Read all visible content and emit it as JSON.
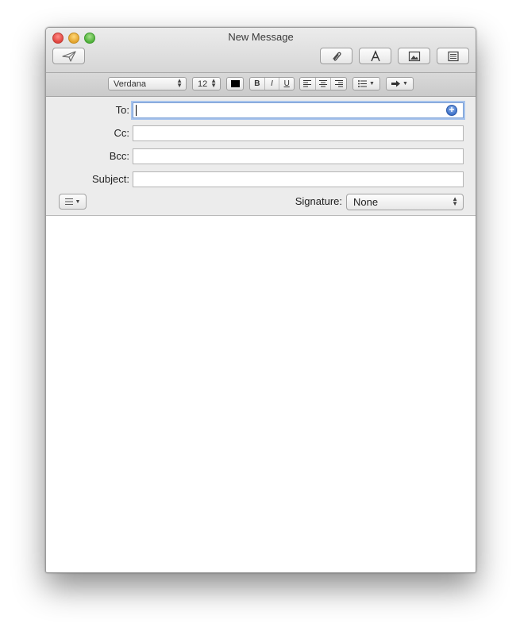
{
  "window": {
    "title": "New Message"
  },
  "toolbar": {
    "send_icon": "paper-plane-icon",
    "attach_icon": "paperclip-icon",
    "fonts_icon": "letter-a-icon",
    "photo_icon": "photo-browser-icon",
    "template_icon": "stationery-icon"
  },
  "format": {
    "font": "Verdana",
    "size": "12",
    "text_color": "#000000",
    "bold": "B",
    "italic": "I",
    "underline": "U"
  },
  "headers": {
    "to_label": "To:",
    "cc_label": "Cc:",
    "bcc_label": "Bcc:",
    "subject_label": "Subject:",
    "to_value": "",
    "cc_value": "",
    "bcc_value": "",
    "subject_value": "",
    "signature_label": "Signature:",
    "signature_value": "None"
  },
  "colors": {
    "focus_ring": "#a8c4ec",
    "add_contact": "#3a6fc8"
  }
}
